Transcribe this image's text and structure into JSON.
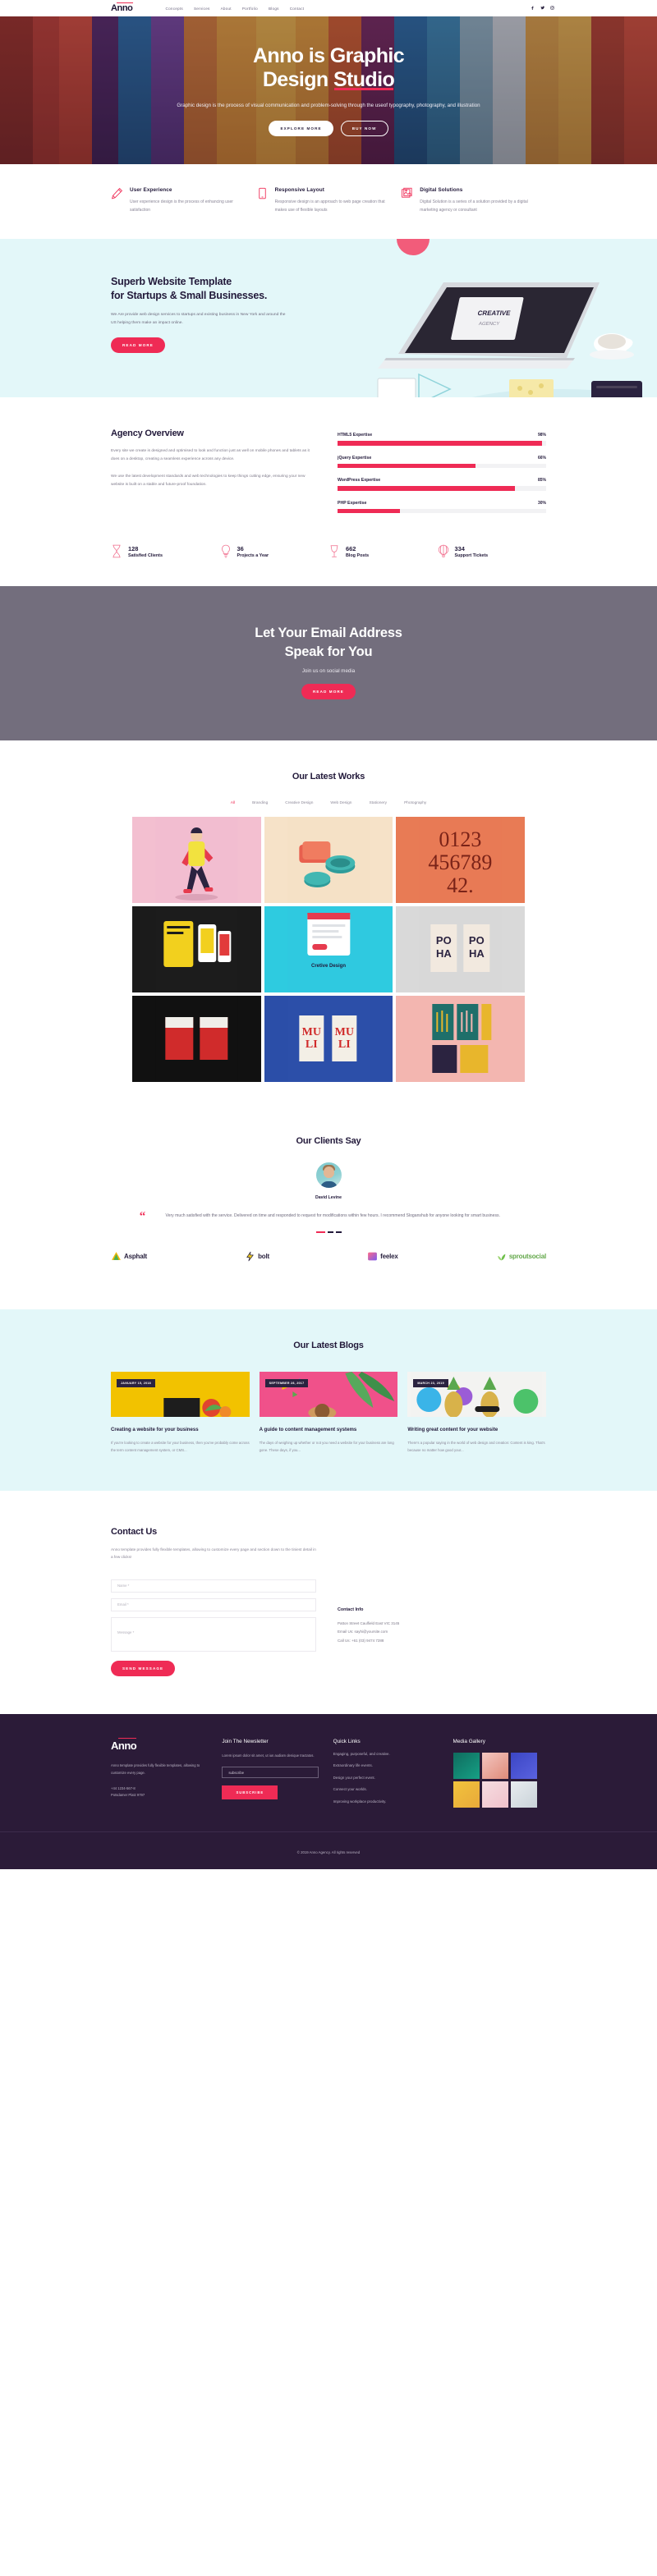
{
  "brand": {
    "name": "Anno",
    "accent": "#ef2b55"
  },
  "header": {
    "nav": [
      {
        "label": "Concepts"
      },
      {
        "label": "Services"
      },
      {
        "label": "About"
      },
      {
        "label": "Portfolio"
      },
      {
        "label": "Blogs"
      },
      {
        "label": "Contact"
      }
    ],
    "socials": [
      {
        "name": "facebook-icon",
        "glyph": "f"
      },
      {
        "name": "twitter-icon",
        "glyph": "✉"
      },
      {
        "name": "instagram-icon",
        "glyph": "▣"
      }
    ]
  },
  "hero": {
    "title_line1": "Anno is Graphic",
    "title_line2_a": "Design ",
    "title_line2_b": "Studio",
    "subtitle": "Graphic design is the process of visual communication and problem-solving through the useof typography, photography, and illustration",
    "btn_primary": "EXPLORE MORE",
    "btn_secondary": "BUY NOW"
  },
  "features": [
    {
      "icon": "pencil-icon",
      "title": "User Experience",
      "text": "User experience design is the process of enhancing user satisfaction"
    },
    {
      "icon": "tablet-icon",
      "title": "Responsive Layout",
      "text": "Responsive design is an approach to web page creation that makes use of flexible layouts"
    },
    {
      "icon": "image-icon",
      "title": "Digital Solutions",
      "text": "Digital Solution is a series of a solution provided by a digital marketing agency or consultant"
    }
  ],
  "promo": {
    "title_line1": "Superb Website Template",
    "title_line2": "for Startups & Small Businesses.",
    "text": "We Are provide web design services to startups and existing business in New York and around the US helping them make an impact online.",
    "button": "READ MORE"
  },
  "agency": {
    "title": "Agency Overview",
    "para1": "Every site we create is designed and optimised to look and function just as well on mobile phones and tablets as it does on a desktop, creating a seamless experience across any device.",
    "para2": "We use the latest development standards and web technologies to keep things cutting edge, ensuring your new website is built on a stable and future-proof foundation.",
    "skills": [
      {
        "name": "HTML5 Expertise",
        "percent": "98%",
        "value": 98
      },
      {
        "name": "jQuery Expertise",
        "percent": "66%",
        "value": 66
      },
      {
        "name": "WordPress Expertise",
        "percent": "85%",
        "value": 85
      },
      {
        "name": "PHP Expertise",
        "percent": "30%",
        "value": 30
      }
    ]
  },
  "stats": [
    {
      "icon": "hourglass-icon",
      "number": "128",
      "label": "Satisfied Clients"
    },
    {
      "icon": "bulb-icon",
      "number": "36",
      "label": "Projects a Year"
    },
    {
      "icon": "wineglass-icon",
      "number": "662",
      "label": "Blog Posts"
    },
    {
      "icon": "balloon-icon",
      "number": "334",
      "label": "Support Tickets"
    }
  ],
  "cta": {
    "title_line1": "Let Your Email Address",
    "title_line2": "Speak for You",
    "subtitle": "Join us on social media",
    "button": "READ MORE"
  },
  "works": {
    "title": "Our Latest Works",
    "filters": [
      {
        "label": "All",
        "active": true
      },
      {
        "label": "Branding",
        "active": false
      },
      {
        "label": "Creative Design",
        "active": false
      },
      {
        "label": "Web Design",
        "active": false
      },
      {
        "label": "Stationery",
        "active": false
      },
      {
        "label": "Photography",
        "active": false
      }
    ],
    "tiles": [
      {
        "label": ""
      },
      {
        "label": ""
      },
      {
        "label": ""
      },
      {
        "label": ""
      },
      {
        "label": "Cretive Design"
      },
      {
        "label": ""
      },
      {
        "label": ""
      },
      {
        "label": ""
      },
      {
        "label": ""
      }
    ]
  },
  "clients": {
    "title": "Our Clients Say",
    "name": "David Levine",
    "quote": "Very much satisfied with the service. Delivered on time and responded to request for modifications within few hours. I recommend Sloganshub for anyone looking for smart business."
  },
  "logos": [
    {
      "name": "Asphalt"
    },
    {
      "name": "bolt"
    },
    {
      "name": "feelex"
    },
    {
      "name": "sproutsocial"
    }
  ],
  "blogs": {
    "title": "Our Latest Blogs",
    "posts": [
      {
        "date": "JANUARY 15, 2018",
        "title": "Creating a website for your business",
        "excerpt": "If you're looking to create a website for your business, then you've probably come across the term content management system, or CMS..."
      },
      {
        "date": "SEPTEMBER 28, 2017",
        "title": "A guide to content management systems",
        "excerpt": "The days of weighing up whether or not you need a website for your business are long gone. These days, if you..."
      },
      {
        "date": "MARCH 23, 2019",
        "title": "Writing great content for your website",
        "excerpt": "There's a popular saying in the world of web design and creation: Content is king. That's because no matter how good your..."
      }
    ]
  },
  "contact": {
    "title": "Contact Us",
    "lead": "Anno template provides fully flexible templates, allowing to customize every page and section down to the tiniest detail in a few clicks!",
    "fields": [
      {
        "placeholder": "Name *"
      },
      {
        "placeholder": "Email *"
      }
    ],
    "textarea_placeholder": "Message *",
    "submit": "SEND MESSAGE",
    "info_title": "Contact Info",
    "address": "Patton Street Caulfield East VIC 3145",
    "email": "Email Us: sayhi@yoursite.com",
    "phone": "Call Us: +61 (03) 9474 7288"
  },
  "footer": {
    "logo": "Anno",
    "description": "Anno template provides fully flexible templates, allowing to customize every page.",
    "phone": "+44 1234-567-8",
    "address": "Potsdamer Platz 9797",
    "newsletter_title": "Join The Newsletter",
    "newsletter_note": "Lorem ipsum dolor sit amet, ut ius audiam denique tractatos.",
    "newsletter_placeholder": "subscribe",
    "newsletter_button": "SUBSCRIBE",
    "quick_links_title": "Quick Links",
    "quick_links": [
      {
        "label": "Engaging, purposeful, and creative."
      },
      {
        "label": "Extraordinary life events."
      },
      {
        "label": "Design your perfect event."
      },
      {
        "label": "Connect your worlds."
      },
      {
        "label": "Improving workplace productivity."
      }
    ],
    "media_title": "Media Gallery",
    "copyright": "© 2019 Anno Agency. All rights reserved"
  }
}
